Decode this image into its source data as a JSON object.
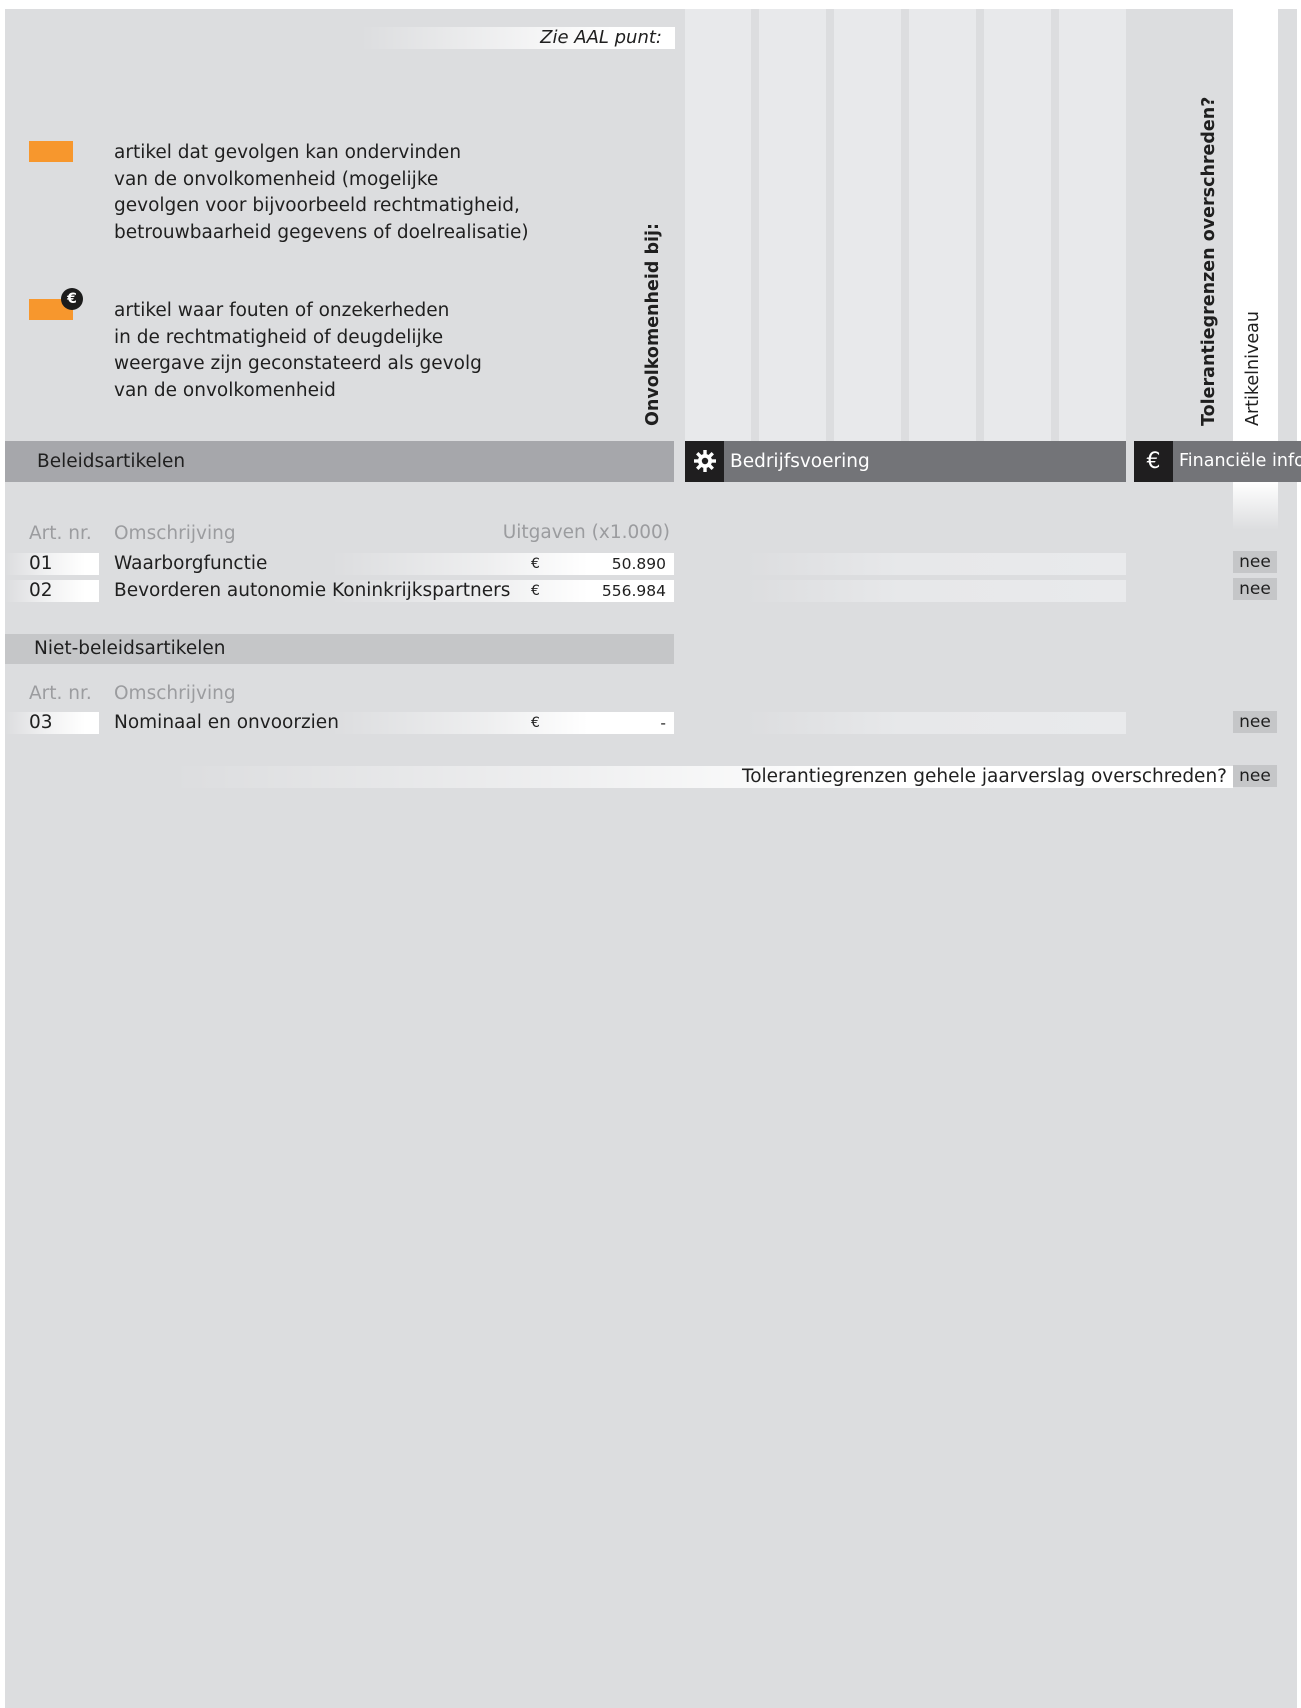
{
  "header": {
    "aal_label": "Zie AAL punt:",
    "onvolkomenheid_label": "Onvolkomenheid bij:",
    "tolerantie_label": "Tolerantiegrenzen overschreden?",
    "artikelniveau_label": "Artikelniveau"
  },
  "legend": {
    "colors": {
      "swatch": "#f7972d",
      "badge": "#1c1c1c"
    },
    "items": [
      {
        "icon": "orange-swatch",
        "text_lines": [
          "artikel dat gevolgen kan ondervinden",
          "van de onvolkomenheid (mogelijke",
          "gevolgen voor bijvoorbeeld rechtmatigheid,",
          "betrouwbaarheid gegevens of doelrealisatie)"
        ]
      },
      {
        "icon": "orange-swatch-euro-badge",
        "badge_symbol": "€",
        "text_lines": [
          "artikel waar fouten of onzekerheden",
          "in de rechtmatigheid of deugdelijke",
          "weergave zijn geconstateerd als gevolg",
          "van de onvolkomenheid"
        ]
      }
    ]
  },
  "sections": {
    "beleid_title": "Beleidsartikelen",
    "bedrijfsvoering_title": "Bedrijfsvoering",
    "financiele_title": "Financiële info",
    "niet_beleid_title": "Niet-beleidsartikelen",
    "gear_icon": "gear-icon",
    "euro_icon": "€"
  },
  "columns": {
    "art_nr": "Art. nr.",
    "omschrijving": "Omschrijving",
    "uitgaven": "Uitgaven (x1.000)"
  },
  "beleid_rows": [
    {
      "nr": "01",
      "omschrijving": "Waarborgfunctie",
      "currency": "€",
      "amount": "50.890",
      "artikelniveau": "nee"
    },
    {
      "nr": "02",
      "omschrijving": "Bevorderen autonomie Koninkrijkspartners",
      "currency": "€",
      "amount": "556.984",
      "artikelniveau": "nee"
    }
  ],
  "niet_beleid_rows": [
    {
      "nr": "03",
      "omschrijving": "Nominaal en onvoorzien",
      "currency": "€",
      "amount": "-",
      "artikelniveau": "nee"
    }
  ],
  "footer": {
    "question": "Tolerantiegrenzen gehele jaarverslag overschreden?",
    "answer": "nee"
  }
}
